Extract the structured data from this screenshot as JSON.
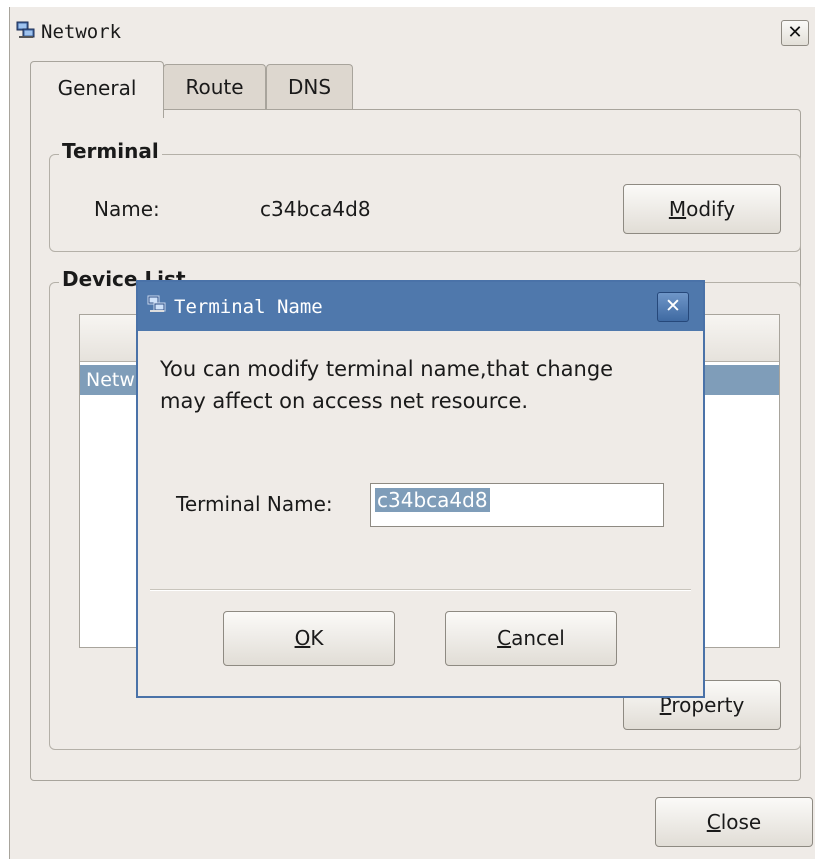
{
  "window": {
    "title": "Network",
    "close_glyph": "✕"
  },
  "tabs": [
    {
      "label": "General",
      "active": true
    },
    {
      "label": "Route",
      "active": false
    },
    {
      "label": "DNS",
      "active": false
    }
  ],
  "terminal": {
    "legend": "Terminal",
    "name_label": "Name:",
    "name_value": "c34bca4d8",
    "modify_button": {
      "mnemonic": "M",
      "rest": "odify"
    }
  },
  "device_list": {
    "legend": "Device List",
    "rows": [
      "Netw"
    ],
    "property_button": {
      "mnemonic": "P",
      "rest": "roperty"
    }
  },
  "close_button": {
    "mnemonic": "C",
    "rest": "lose"
  },
  "dialog": {
    "title": "Terminal Name",
    "close_glyph": "✕",
    "message_line1": "You can modify terminal name,that change",
    "message_line2": "may affect on access net resource.",
    "field_label": "Terminal Name:",
    "field_value": "c34bca4d8",
    "ok_button": {
      "mnemonic": "O",
      "rest": "K"
    },
    "cancel_button": {
      "mnemonic": "C",
      "rest": "ancel"
    }
  },
  "colors": {
    "window_bg": "#efebe7",
    "dialog_title": "#4f78ac",
    "selection": "#7f9db9"
  },
  "icons": {
    "window": "network-computers-icon",
    "dialog": "network-computers-icon"
  }
}
